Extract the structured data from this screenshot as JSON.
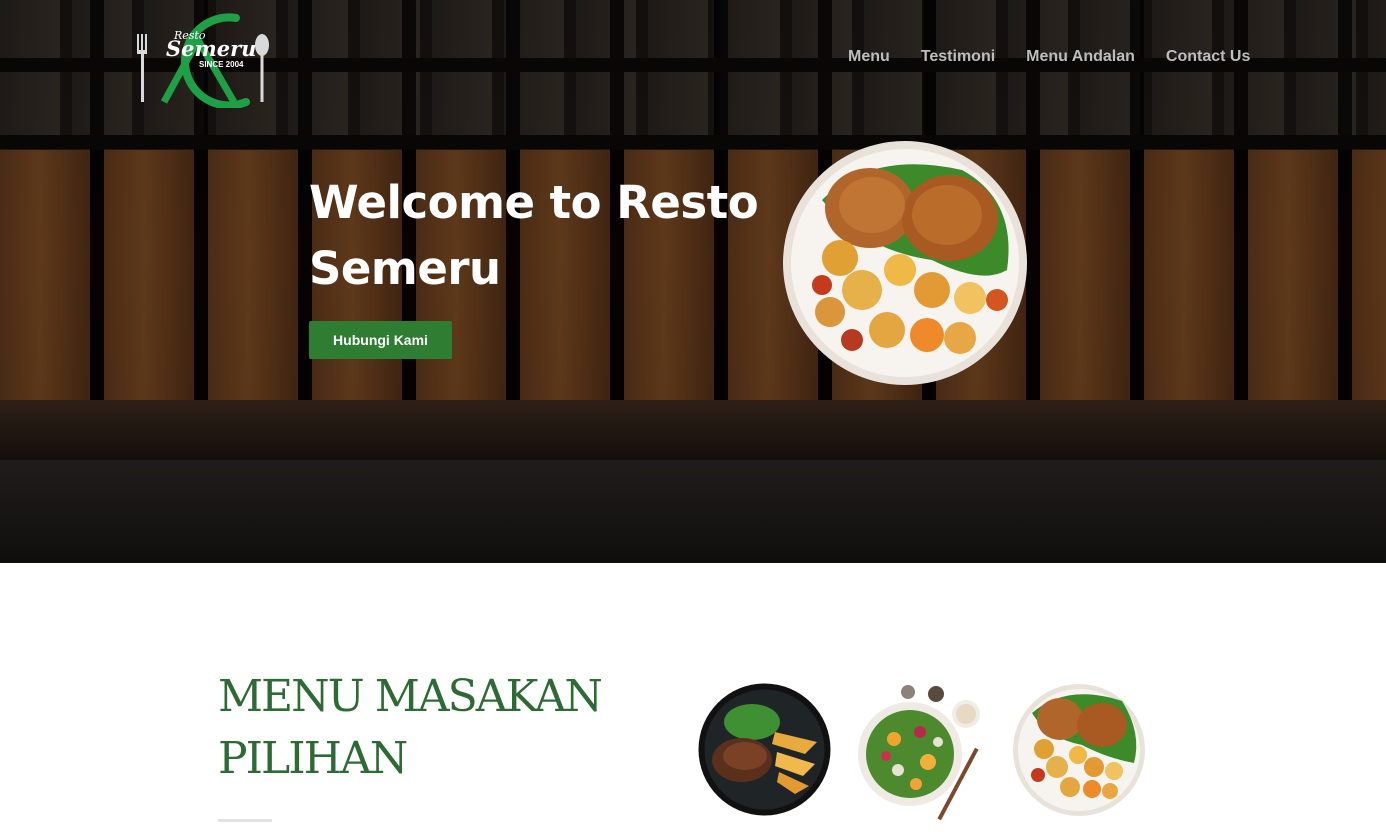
{
  "logo": {
    "brand_small": "Resto",
    "brand_main": "Semeru",
    "tagline": "SINCE 2004"
  },
  "nav": {
    "items": [
      "Menu",
      "Testimoni",
      "Menu Andalan",
      "Contact Us"
    ]
  },
  "hero": {
    "title": "Welcome to Resto Semeru",
    "cta_label": "Hubungi Kami"
  },
  "menu_section": {
    "title": "MENU MASAKAN PILIHAN"
  },
  "colors": {
    "brand_green": "#2e7d32",
    "title_green": "#2e6b34",
    "nav_text": "#bdbdbd"
  }
}
